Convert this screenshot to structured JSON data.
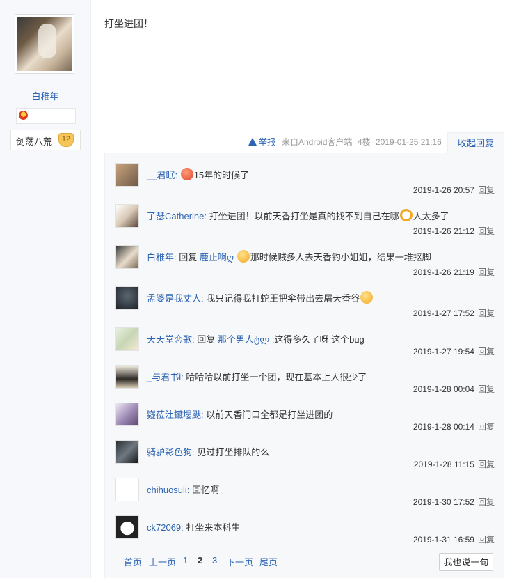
{
  "author": {
    "username": "白稚年",
    "level_name": "剑荡八荒",
    "level_num": "12"
  },
  "post": {
    "content": "打坐进团！",
    "report_label": "举报",
    "source": "来自Android客户端",
    "floor": "4楼",
    "time": "2019-01-25 21:16",
    "collapse_label": "收起回复"
  },
  "replies": [
    {
      "name": "__君眠:",
      "prefix": "",
      "quote": "",
      "text": "15年的时候了",
      "emoji": "red-face-emoji",
      "emoji_pos": "before",
      "time": "2019-1-26 20:57",
      "reply_label": "回复"
    },
    {
      "name": "了瑟Catherine:",
      "prefix": "",
      "quote": "",
      "text": "打坐进团！以前天香打坐是真的找不到自己在哪",
      "text2": "人太多了",
      "emoji": "ring-face-emoji",
      "emoji_pos": "middle",
      "time": "2019-1-26 21:12",
      "reply_label": "回复"
    },
    {
      "name": "白稚年:",
      "prefix": "回复",
      "quote": "鹿止啊ღ",
      "text2": "那时候贼多人去天香钓小姐姐，结果一堆抠脚",
      "emoji": "smile-face-emoji",
      "emoji_pos": "middle",
      "time": "2019-1-26 21:19",
      "reply_label": "回复"
    },
    {
      "name": "孟婆是我丈人:",
      "prefix": "",
      "quote": "",
      "text": "我只记得我打蛇王把伞带出去屠天香谷",
      "emoji": "smile-face-emoji",
      "emoji_pos": "after",
      "time": "2019-1-27 17:52",
      "reply_label": "回复"
    },
    {
      "name": "天天堂恋歌:",
      "prefix": "回复",
      "quote": "那个男人ტლ",
      "text": ":这得多久了呀 这个bug",
      "time": "2019-1-27 19:54",
      "reply_label": "回复"
    },
    {
      "name": "_与君书i:",
      "prefix": "",
      "quote": "",
      "text": "哈哈哈以前打坐一个团，现在基本上人很少了",
      "time": "2019-1-28 00:04",
      "reply_label": "回复"
    },
    {
      "name": "嶷莅汢鑶塿颫:",
      "prefix": "",
      "quote": "",
      "text": "以前天香门口全都是打坐进团的",
      "time": "2019-1-28 00:14",
      "reply_label": "回复"
    },
    {
      "name": "骑驴彩色狗:",
      "prefix": "",
      "quote": "",
      "text": "见过打坐排队的么",
      "time": "2019-1-28 11:15",
      "reply_label": "回复"
    },
    {
      "name": "chihuosuli:",
      "prefix": "",
      "quote": "",
      "text": "回忆啊",
      "time": "2019-1-30 17:52",
      "reply_label": "回复"
    },
    {
      "name": "ck72069:",
      "prefix": "",
      "quote": "",
      "text": "打坐来本科生",
      "time": "2019-1-31 16:59",
      "reply_label": "回复"
    }
  ],
  "pagination": {
    "first": "首页",
    "prev": "上一页",
    "p1": "1",
    "p2": "2",
    "p3": "3",
    "next": "下一页",
    "last": "尾页"
  },
  "say_button": "我也说一句",
  "colors": {
    "link": "#2d64b3",
    "panel_bg": "#f7f8fa",
    "sidebar_bg": "#f6f8fc"
  }
}
